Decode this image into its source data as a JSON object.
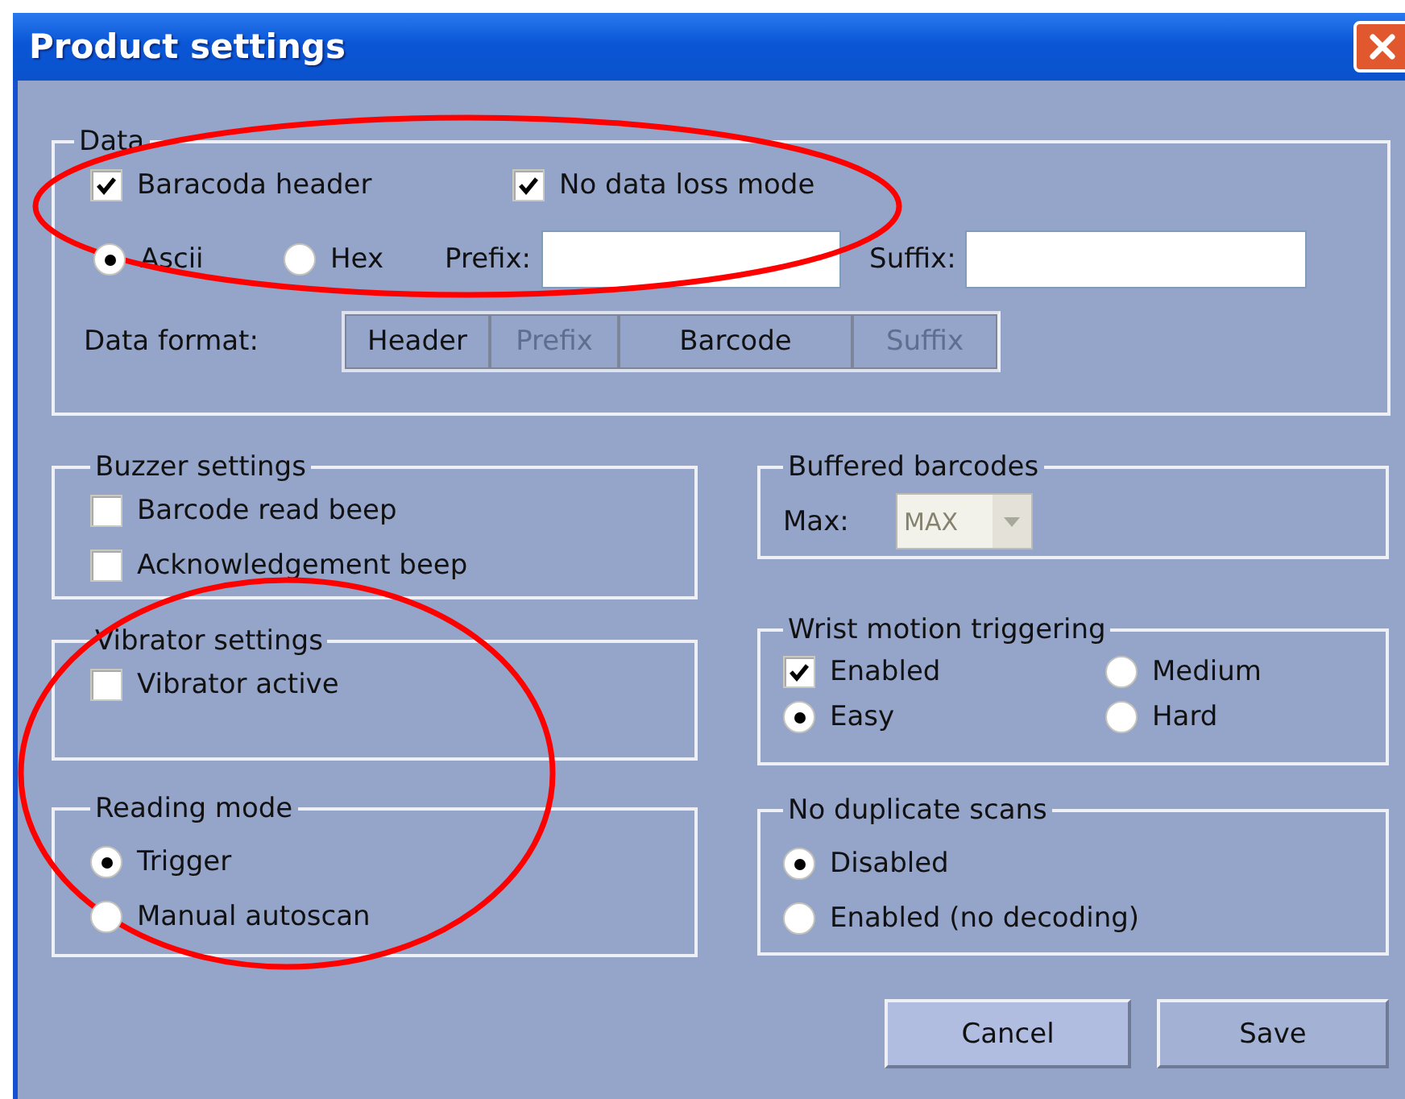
{
  "window": {
    "title": "Product settings"
  },
  "data": {
    "title": "Data",
    "checkboxes": [
      {
        "label": "Baracoda header",
        "checked": true
      },
      {
        "label": "No data loss mode",
        "checked": true
      }
    ],
    "encoding": [
      {
        "label": "Ascii",
        "selected": true
      },
      {
        "label": "Hex",
        "selected": false
      }
    ],
    "prefix": {
      "label": "Prefix:"
    },
    "suffix": {
      "label": "Suffix:"
    },
    "format": {
      "label": "Data format:",
      "segments": [
        {
          "label": "Header",
          "disabled": false
        },
        {
          "label": "Prefix",
          "disabled": true
        },
        {
          "label": "Barcode",
          "disabled": false
        },
        {
          "label": "Suffix",
          "disabled": true
        }
      ]
    }
  },
  "buzzer": {
    "title": "Buzzer settings",
    "checkboxes": [
      {
        "label": "Barcode read beep",
        "checked": false
      },
      {
        "label": "Acknowledgement beep",
        "checked": false
      }
    ]
  },
  "vibrator": {
    "title": "Vibrator settings",
    "checkboxes": [
      {
        "label": "Vibrator active",
        "checked": false
      }
    ]
  },
  "reading_mode": {
    "title": "Reading mode",
    "options": [
      {
        "label": "Trigger",
        "selected": true
      },
      {
        "label": "Manual autoscan",
        "selected": false
      }
    ]
  },
  "buffered": {
    "title": "Buffered barcodes",
    "label": "Max:",
    "combo": {
      "value": "MAX",
      "disabled": true
    }
  },
  "wrist": {
    "title": "Wrist motion triggering",
    "enabled": {
      "label": "Enabled",
      "checked": true
    },
    "levels": [
      {
        "label": "Easy",
        "selected": true
      },
      {
        "label": "Medium",
        "selected": false
      },
      {
        "label": "Hard",
        "selected": false
      }
    ]
  },
  "no_duplicate": {
    "title": "No duplicate scans",
    "options": [
      {
        "label": "Disabled",
        "selected": true
      },
      {
        "label": "Enabled (no decoding)",
        "selected": false
      }
    ]
  },
  "buttons": [
    {
      "label": "Cancel"
    },
    {
      "label": "Save"
    }
  ],
  "annotations": [
    {
      "kind": "ellipse",
      "color": "#ff0000"
    },
    {
      "kind": "ellipse",
      "color": "#ff0000"
    }
  ]
}
